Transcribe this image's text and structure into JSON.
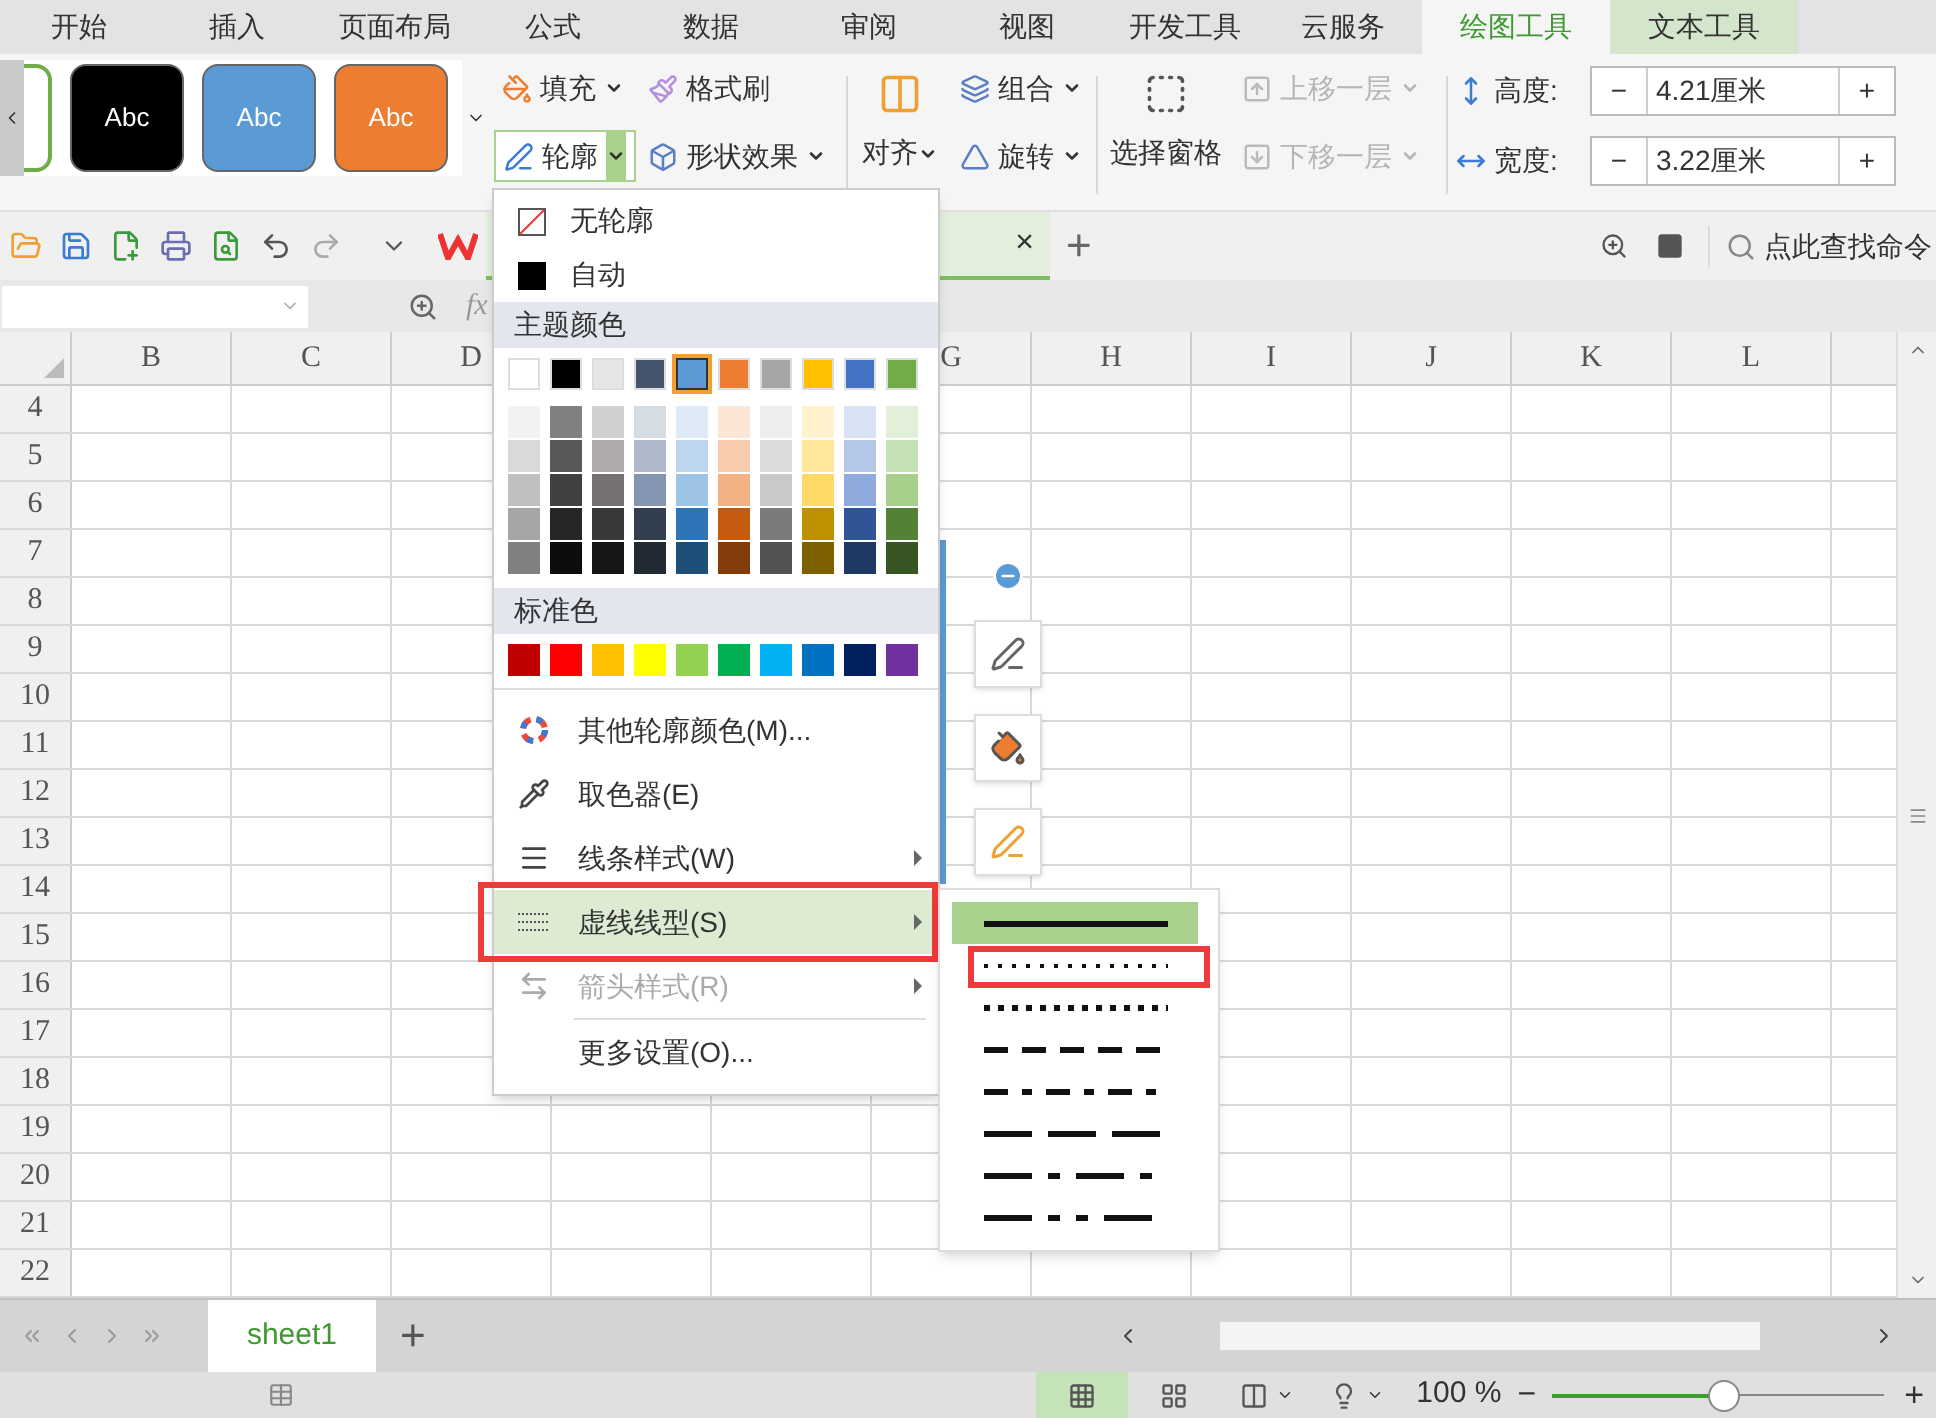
{
  "ribbon_tabs": [
    {
      "label": "开始",
      "selected": false,
      "contextual": false
    },
    {
      "label": "插入",
      "selected": false,
      "contextual": false
    },
    {
      "label": "页面布局",
      "selected": false,
      "contextual": false
    },
    {
      "label": "公式",
      "selected": false,
      "contextual": false
    },
    {
      "label": "数据",
      "selected": false,
      "contextual": false
    },
    {
      "label": "审阅",
      "selected": false,
      "contextual": false
    },
    {
      "label": "视图",
      "selected": false,
      "contextual": false
    },
    {
      "label": "开发工具",
      "selected": false,
      "contextual": false
    },
    {
      "label": "云服务",
      "selected": false,
      "contextual": false
    },
    {
      "label": "绘图工具",
      "selected": true,
      "contextual": true
    },
    {
      "label": "文本工具",
      "selected": false,
      "contextual": true
    }
  ],
  "ribbon": {
    "style_gallery": [
      {
        "label": "Abc",
        "color": "#000000"
      },
      {
        "label": "Abc",
        "color": "#5b9bd5"
      },
      {
        "label": "Abc",
        "color": "#ed7d31"
      }
    ],
    "fill": {
      "label": "填充"
    },
    "format_painter": {
      "label": "格式刷"
    },
    "outline": {
      "label": "轮廓",
      "open": true
    },
    "shape_effects": {
      "label": "形状效果"
    },
    "align": {
      "label": "对齐"
    },
    "group": {
      "label": "组合"
    },
    "rotate": {
      "label": "旋转"
    },
    "selection_pane": {
      "label": "选择窗格"
    },
    "bring_forward": {
      "label": "上移一层",
      "disabled": true
    },
    "send_backward": {
      "label": "下移一层",
      "disabled": true
    },
    "size_fields": [
      {
        "label": "高度:",
        "value": "4.21厘米",
        "decrement": "−",
        "increment": "+"
      },
      {
        "label": "宽度:",
        "value": "3.22厘米",
        "decrement": "−",
        "increment": "+"
      }
    ]
  },
  "quick_access": {
    "close_tab": "×",
    "new_tab": "+",
    "search": "点此查找命令"
  },
  "formula_bar": {
    "fx": "fx"
  },
  "sheet": {
    "columns": [
      "B",
      "C",
      "D",
      "G",
      "H",
      "I",
      "J",
      "K",
      "L"
    ],
    "rows": [
      "4",
      "5",
      "6",
      "7",
      "8",
      "9",
      "10",
      "11",
      "12",
      "13",
      "14",
      "15",
      "16",
      "17",
      "18",
      "19",
      "20",
      "21",
      "22"
    ]
  },
  "outline_menu": {
    "no_outline": "无轮廓",
    "automatic": "自动",
    "theme_heading": "主题颜色",
    "standard_heading": "标准色",
    "theme_colors": [
      {
        "color": "#ffffff",
        "selected": false,
        "shades": [
          {
            "color": "#f2f2f2"
          },
          {
            "color": "#d9d9d9"
          },
          {
            "color": "#bfbfbf"
          },
          {
            "color": "#a6a6a6"
          },
          {
            "color": "#808080"
          }
        ]
      },
      {
        "color": "#000000",
        "selected": false,
        "shades": [
          {
            "color": "#808080"
          },
          {
            "color": "#595959"
          },
          {
            "color": "#404040"
          },
          {
            "color": "#262626"
          },
          {
            "color": "#0d0d0d"
          }
        ]
      },
      {
        "color": "#e7e6e6",
        "selected": false,
        "shades": [
          {
            "color": "#d0cece"
          },
          {
            "color": "#aeaaaa"
          },
          {
            "color": "#757171"
          },
          {
            "color": "#3a3838"
          },
          {
            "color": "#171616"
          }
        ]
      },
      {
        "color": "#44546a",
        "selected": false,
        "shades": [
          {
            "color": "#d6dce4"
          },
          {
            "color": "#adb9ca"
          },
          {
            "color": "#8496b0"
          },
          {
            "color": "#323f4f"
          },
          {
            "color": "#222a35"
          }
        ]
      },
      {
        "color": "#5b9bd5",
        "selected": true,
        "shades": [
          {
            "color": "#deebf6"
          },
          {
            "color": "#bdd7ee"
          },
          {
            "color": "#9dc3e6"
          },
          {
            "color": "#2e75b5"
          },
          {
            "color": "#1f4e79"
          }
        ]
      },
      {
        "color": "#ed7d31",
        "selected": false,
        "shades": [
          {
            "color": "#fbe5d5"
          },
          {
            "color": "#f8cbad"
          },
          {
            "color": "#f4b183"
          },
          {
            "color": "#c55a11"
          },
          {
            "color": "#843c0b"
          }
        ]
      },
      {
        "color": "#a5a5a5",
        "selected": false,
        "shades": [
          {
            "color": "#ededed"
          },
          {
            "color": "#dbdbdb"
          },
          {
            "color": "#c9c9c9"
          },
          {
            "color": "#7b7b7b"
          },
          {
            "color": "#525252"
          }
        ]
      },
      {
        "color": "#ffc000",
        "selected": false,
        "shades": [
          {
            "color": "#fff2cc"
          },
          {
            "color": "#ffe699"
          },
          {
            "color": "#ffd966"
          },
          {
            "color": "#bf9000"
          },
          {
            "color": "#7f6000"
          }
        ]
      },
      {
        "color": "#4472c4",
        "selected": false,
        "shades": [
          {
            "color": "#d9e2f3"
          },
          {
            "color": "#b4c7e7"
          },
          {
            "color": "#8faadc"
          },
          {
            "color": "#2f5597"
          },
          {
            "color": "#1f3864"
          }
        ]
      },
      {
        "color": "#70ad47",
        "selected": false,
        "shades": [
          {
            "color": "#e2efd9"
          },
          {
            "color": "#c5e0b3"
          },
          {
            "color": "#a8d08d"
          },
          {
            "color": "#538135"
          },
          {
            "color": "#375623"
          }
        ]
      }
    ],
    "standard_colors": [
      {
        "color": "#c00000"
      },
      {
        "color": "#ff0000"
      },
      {
        "color": "#ffc000"
      },
      {
        "color": "#ffff00"
      },
      {
        "color": "#92d050"
      },
      {
        "color": "#00b050"
      },
      {
        "color": "#00b0f0"
      },
      {
        "color": "#0070c0"
      },
      {
        "color": "#002060"
      },
      {
        "color": "#7030a0"
      }
    ],
    "actions": [
      {
        "label": "其他轮廓颜色(M)...",
        "submenu": false,
        "disabled": false,
        "highlighted": false,
        "annotated": false
      },
      {
        "label": "取色器(E)",
        "submenu": false,
        "disabled": false,
        "highlighted": false,
        "annotated": false
      },
      {
        "label": "线条样式(W)",
        "submenu": true,
        "disabled": false,
        "highlighted": false,
        "annotated": false
      },
      {
        "label": "虚线线型(S)",
        "submenu": true,
        "disabled": false,
        "highlighted": true,
        "annotated": true
      },
      {
        "label": "箭头样式(R)",
        "submenu": true,
        "disabled": true,
        "highlighted": false,
        "annotated": false
      },
      {
        "label": "更多设置(O)...",
        "submenu": false,
        "disabled": false,
        "highlighted": false,
        "annotated": false
      }
    ]
  },
  "dash_submenu": [
    {
      "kind": "solid",
      "selected": true,
      "annotated": false
    },
    {
      "kind": "round_dot",
      "selected": false,
      "annotated": true
    },
    {
      "kind": "square_dot",
      "selected": false,
      "annotated": false
    },
    {
      "kind": "dash",
      "selected": false,
      "annotated": false
    },
    {
      "kind": "dash_dot",
      "selected": false,
      "annotated": false
    },
    {
      "kind": "long_dash",
      "selected": false,
      "annotated": false
    },
    {
      "kind": "long_dash_dot",
      "selected": false,
      "annotated": false
    },
    {
      "kind": "long_dash_dot_dot",
      "selected": false,
      "annotated": false
    }
  ],
  "sheet_tabs": {
    "tabs": [
      {
        "label": "sheet1",
        "selected": true
      }
    ],
    "add": "+"
  },
  "status_bar": {
    "views": [
      {
        "selected": true
      },
      {
        "selected": false
      }
    ],
    "zoom_label": "100 %",
    "zoom_out": "−",
    "zoom_in": "+",
    "zoom": {
      "level": 0.52
    }
  }
}
